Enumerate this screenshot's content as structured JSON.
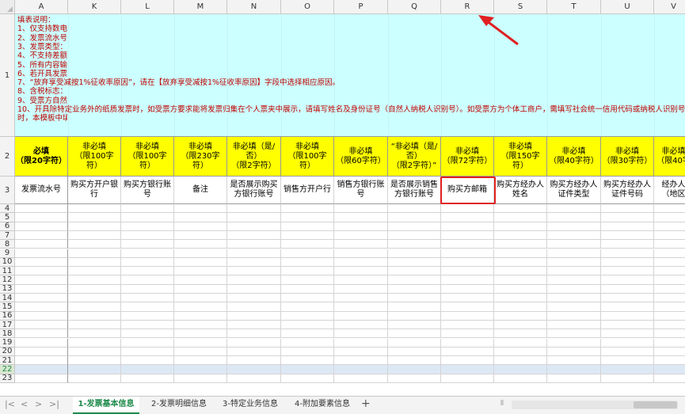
{
  "columns": [
    "A",
    "K",
    "L",
    "M",
    "N",
    "O",
    "P",
    "Q",
    "R",
    "S",
    "T",
    "U",
    "V"
  ],
  "rows": [
    "1",
    "2",
    "3",
    "4",
    "5",
    "6",
    "7",
    "8",
    "9",
    "10",
    "11",
    "12",
    "13",
    "14",
    "15",
    "16",
    "17",
    "18",
    "19",
    "20",
    "21",
    "22",
    "23"
  ],
  "instructions": [
    "填表说明：",
    "1、仅支持数电",
    "2、发票流水号",
    "3、发票类型：",
    "4、不支持差额",
    "5、所有内容输",
    "6、若开具发票",
    "7、“放弃享受减按1%征收率原因”，请在【放弃享受减按1%征收率原因】字段中选择相应原因。",
    "8、含税标志：",
    "9、受票方自然",
    "10、开具除特定业务外的纸质发票时，如受票方要求能将发票归集在个人票夹中展示，请填写姓名及身份证号（自然人纳税人识别号）。如受票方为个体工商户，需填写社会统一信用代码或纳税人识别号，并在受票方自",
    "时，本模板中填"
  ],
  "row2": [
    {
      "line1": "必填",
      "line2": "（限20字符）"
    },
    {
      "line1": "非必填",
      "line2": "（限100字符）"
    },
    {
      "line1": "非必填",
      "line2": "（限100字符）"
    },
    {
      "line1": "非必填",
      "line2": "（限230字符）"
    },
    {
      "line1": "非必填（是/否）",
      "line2": "（限2字符）"
    },
    {
      "line1": "非必填",
      "line2": "（限100字符）"
    },
    {
      "line1": "非必填",
      "line2": "（限60字符）"
    },
    {
      "line1": "“非必填（是/否）",
      "line2": "（限2字符）”"
    },
    {
      "line1": "非必填",
      "line2": "（限72字符）"
    },
    {
      "line1": "非必填",
      "line2": "（限150字符）"
    },
    {
      "line1": "非必填",
      "line2": "（限40字符）"
    },
    {
      "line1": "非必填",
      "line2": "（限30字符）"
    },
    {
      "line1": "非必填",
      "line2": "（限40字"
    }
  ],
  "row3": [
    "发票流水号",
    "购买方开户银行",
    "购买方银行账号",
    "备注",
    "是否展示购买方银行账号",
    "销售方开户行",
    "销售方银行账号",
    "是否展示销售方银行账号",
    "购买方邮箱",
    "购买方经办人姓名",
    "购买方经办人证件类型",
    "购买方经办人证件号码",
    "经办人（地区"
  ],
  "selected_row": "22",
  "sheet_tabs": [
    {
      "label": "1-发票基本信息",
      "active": true
    },
    {
      "label": "2-发票明细信息",
      "active": false
    },
    {
      "label": "3-特定业务信息",
      "active": false
    },
    {
      "label": "4-附加要素信息",
      "active": false
    }
  ],
  "nav_icons": [
    "first-sheet-icon",
    "prev-sheet-icon",
    "next-sheet-icon",
    "last-sheet-icon"
  ],
  "colors": {
    "instruction_bg": "#ccffff",
    "required_header_bg": "#ffff00",
    "instruction_text": "#c00000",
    "highlight": "#e02020",
    "active_tab": "#1e8a4c"
  }
}
